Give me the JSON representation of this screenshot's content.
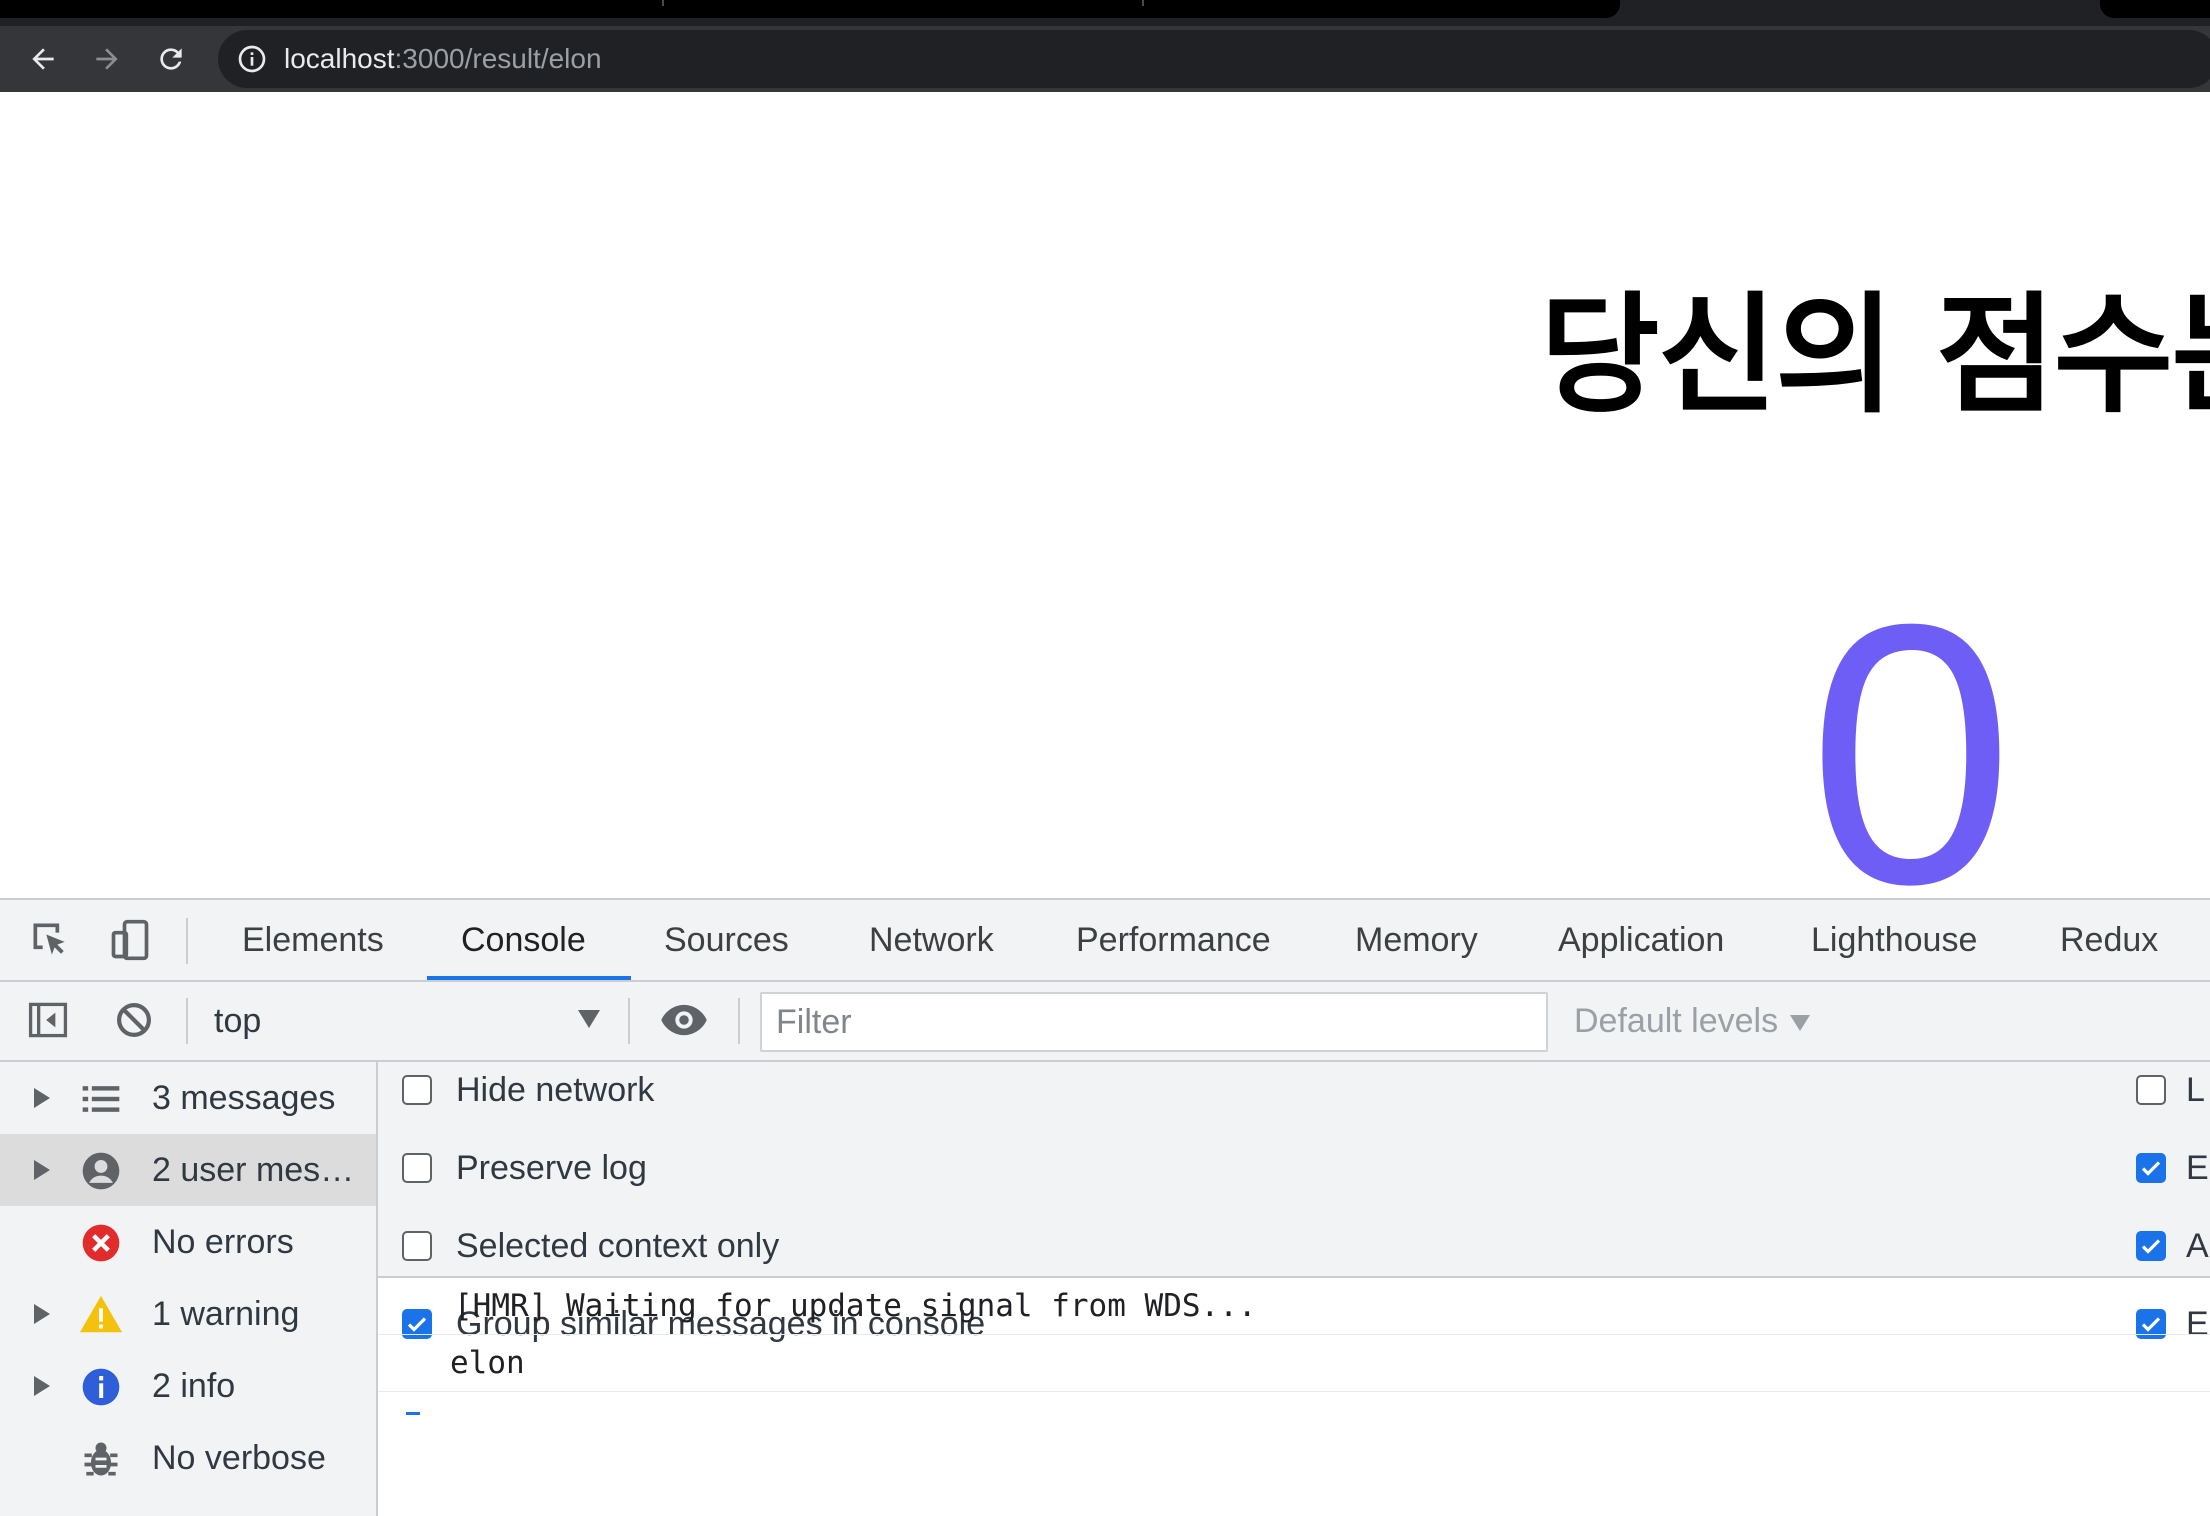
{
  "browser": {
    "url_host": "localhost",
    "url_path": ":3000/result/elon"
  },
  "page": {
    "heading": "당신의 점수는",
    "score": "0"
  },
  "devtools": {
    "tabs": [
      "Elements",
      "Console",
      "Sources",
      "Network",
      "Performance",
      "Memory",
      "Application",
      "Lighthouse",
      "Redux"
    ],
    "active_tab": "Console",
    "context": "top",
    "filter_placeholder": "Filter",
    "levels": "Default levels",
    "sidebar": [
      {
        "label": "3 messages",
        "icon": "list-icon",
        "expandable": true
      },
      {
        "label": "2 user mes…",
        "icon": "user-icon",
        "expandable": true,
        "selected": true
      },
      {
        "label": "No errors",
        "icon": "error-icon",
        "expandable": false
      },
      {
        "label": "1 warning",
        "icon": "warning-icon",
        "expandable": true
      },
      {
        "label": "2 info",
        "icon": "info-icon",
        "expandable": true
      },
      {
        "label": "No verbose",
        "icon": "bug-icon",
        "expandable": false
      }
    ],
    "settings_left": [
      {
        "label": "Hide network",
        "checked": false
      },
      {
        "label": "Preserve log",
        "checked": false
      },
      {
        "label": "Selected context only",
        "checked": false
      },
      {
        "label": "Group similar messages in console",
        "checked": true
      }
    ],
    "settings_right": [
      {
        "label": "L",
        "checked": false
      },
      {
        "label": "E",
        "checked": true
      },
      {
        "label": "A",
        "checked": true
      },
      {
        "label": "E",
        "checked": true
      }
    ],
    "log": [
      "[HMR] Waiting for update signal from WDS...",
      "elon"
    ]
  },
  "colors": {
    "score": "#6f5ef6",
    "accent": "#1a73e8"
  }
}
